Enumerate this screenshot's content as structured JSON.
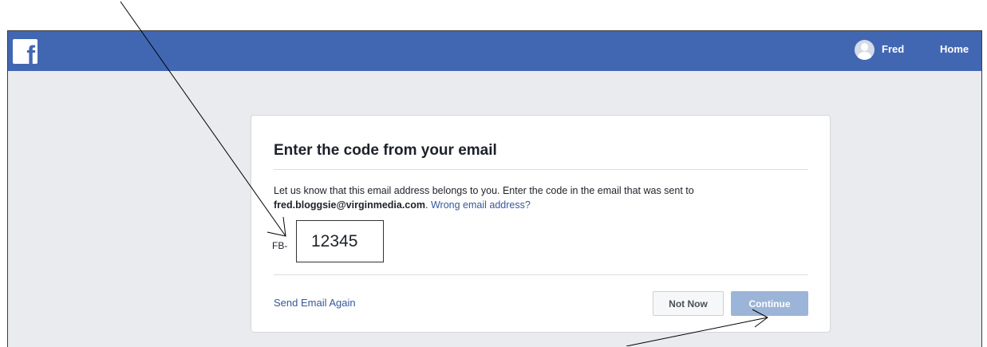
{
  "topbar": {
    "logo_letter": "f",
    "user_name": "Fred",
    "home_label": "Home",
    "color": "#4267b2"
  },
  "dialog": {
    "title": "Enter the code from your email",
    "description_intro": "Let us know that this email address belongs to you. Enter the code in the email that was sent to ",
    "email": "fred.bloggsie@virginmedia.com",
    "description_end": ". ",
    "wrong_email_link": "Wrong email address?",
    "code_prefix": "FB-",
    "code_value": "12345",
    "send_again_link": "Send Email Again",
    "not_now_button": "Not Now",
    "continue_button": "Continue"
  },
  "colors": {
    "page_background": "#e9ebee",
    "link": "#365899",
    "continue_disabled": "#9cb4d8"
  },
  "icons": {
    "logo": "facebook-logo-icon",
    "avatar": "user-avatar-icon",
    "annotation_arrows": [
      "arrow-to-code-input",
      "arrow-to-continue-button"
    ]
  }
}
